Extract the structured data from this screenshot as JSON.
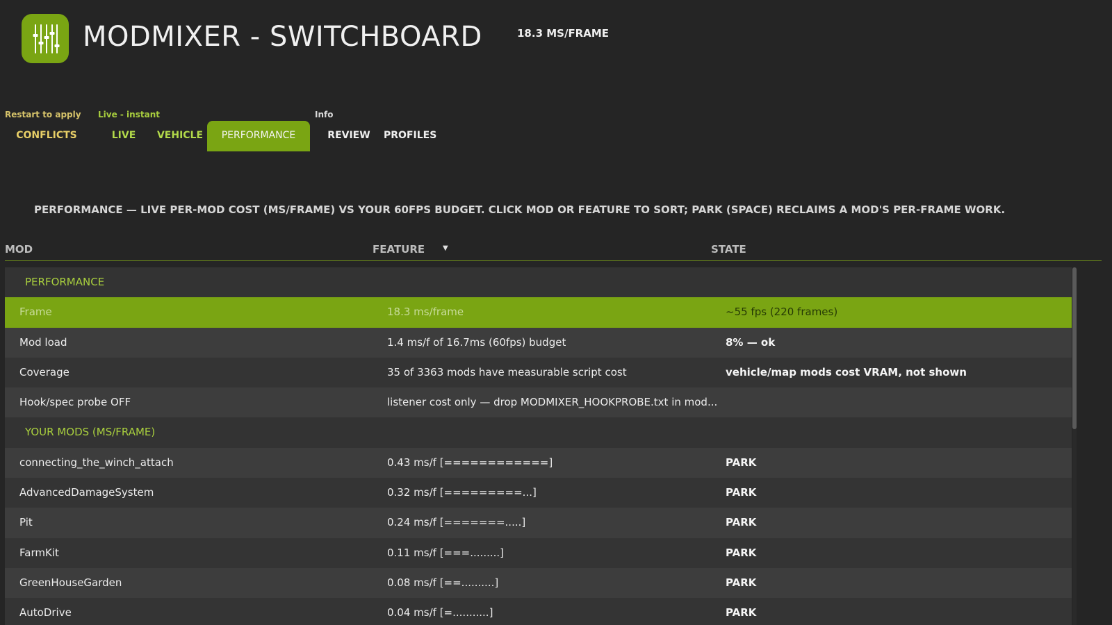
{
  "header": {
    "logo_icon": "mixer-sliders-icon",
    "title": "MODMIXER - SWITCHBOARD",
    "frame_readout": "18.3 MS/FRAME"
  },
  "tabs": {
    "group_labels": {
      "restart": "Restart to apply",
      "live": "Live - instant",
      "info": "Info"
    },
    "items": [
      {
        "label": "CONFLICTS"
      },
      {
        "label": "LIVE"
      },
      {
        "label": "VEHICLE"
      },
      {
        "label": "PERFORMANCE",
        "active": true
      },
      {
        "label": "REVIEW"
      },
      {
        "label": "PROFILES"
      }
    ]
  },
  "description": "PERFORMANCE — LIVE PER-MOD COST (MS/FRAME) VS YOUR 60FPS BUDGET. CLICK MOD OR FEATURE TO SORT; PARK (SPACE) RECLAIMS A MOD'S PER-FRAME WORK.",
  "table": {
    "columns": {
      "mod": "MOD",
      "feature": "FEATURE",
      "state": "STATE",
      "sort_indicator": "▼"
    },
    "sections": [
      {
        "title": "PERFORMANCE",
        "rows": [
          {
            "mod": "Frame",
            "feature": "18.3 ms/frame",
            "state": "~55 fps   (220 frames)"
          },
          {
            "mod": "Mod load",
            "feature": "1.4 ms/f  of 16.7ms (60fps) budget",
            "state": "8%  —  ok"
          },
          {
            "mod": "Coverage",
            "feature": "35 of 3363 mods have measurable script cost",
            "state": "vehicle/map mods cost VRAM, not shown"
          },
          {
            "mod": "Hook/spec probe OFF",
            "feature": "listener cost only — drop MODMIXER_HOOKPROBE.txt in mod...",
            "state": ""
          }
        ]
      },
      {
        "title": "YOUR MODS (MS/FRAME)",
        "rows": [
          {
            "mod": "connecting_the_winch_attach",
            "feature": "0.43 ms/f  [============]",
            "state": "PARK"
          },
          {
            "mod": "AdvancedDamageSystem",
            "feature": "0.32 ms/f  [=========...]",
            "state": "PARK"
          },
          {
            "mod": "Pit",
            "feature": "0.24 ms/f  [=======.....]",
            "state": "PARK"
          },
          {
            "mod": "FarmKit",
            "feature": "0.11 ms/f  [===.........]",
            "state": "PARK"
          },
          {
            "mod": "GreenHouseGarden",
            "feature": "0.08 ms/f  [==..........]",
            "state": "PARK"
          },
          {
            "mod": "AutoDrive",
            "feature": "0.04 ms/f  [=...........]",
            "state": "PARK"
          }
        ]
      }
    ]
  },
  "colors": {
    "accent": "#7aa513",
    "background": "#252525",
    "conflicts_tab": "#e8cf67",
    "live_tabs": "#b2d94a"
  }
}
